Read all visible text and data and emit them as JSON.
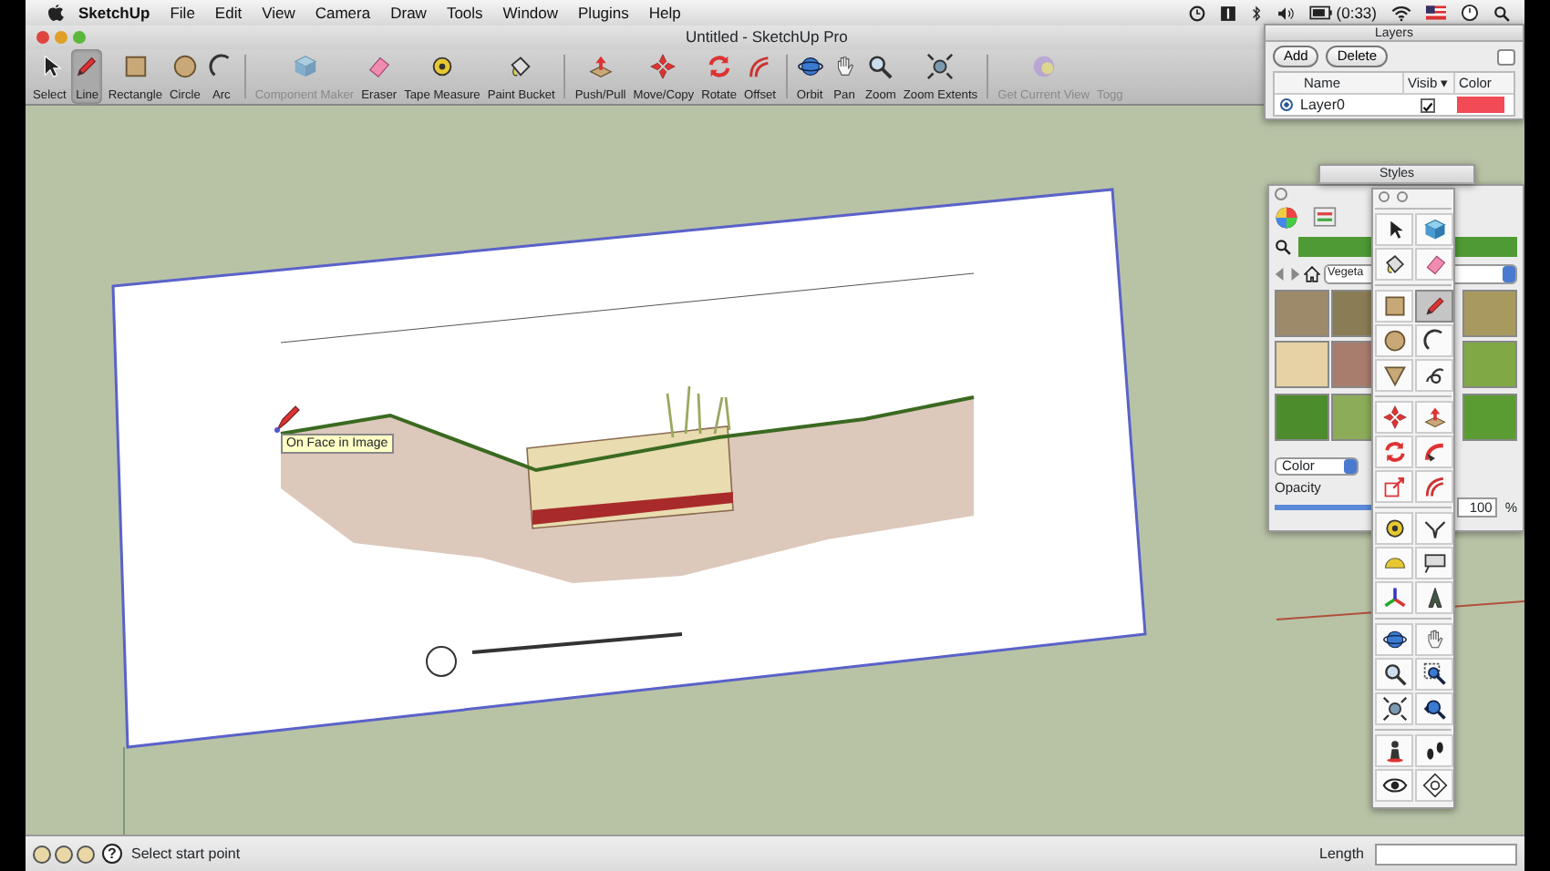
{
  "menubar": {
    "app": "SketchUp",
    "menus": [
      "File",
      "Edit",
      "View",
      "Camera",
      "Draw",
      "Tools",
      "Window",
      "Plugins",
      "Help"
    ],
    "battery": "(0:33)"
  },
  "window": {
    "title": "Untitled - SketchUp Pro"
  },
  "toolbar": [
    [
      {
        "label": "Select",
        "kind": "select",
        "selected": false,
        "disabled": false
      },
      {
        "label": "Line",
        "kind": "line",
        "selected": true,
        "disabled": false
      },
      {
        "label": "Rectangle",
        "kind": "rectangle",
        "selected": false,
        "disabled": false
      },
      {
        "label": "Circle",
        "kind": "circle",
        "selected": false,
        "disabled": false
      },
      {
        "label": "Arc",
        "kind": "arc",
        "selected": false,
        "disabled": false
      }
    ],
    [
      {
        "label": "Component Maker",
        "kind": "component",
        "selected": false,
        "disabled": true
      },
      {
        "label": "Eraser",
        "kind": "eraser",
        "selected": false,
        "disabled": false
      },
      {
        "label": "Tape Measure",
        "kind": "tape",
        "selected": false,
        "disabled": false
      },
      {
        "label": "Paint Bucket",
        "kind": "bucket",
        "selected": false,
        "disabled": false
      }
    ],
    [
      {
        "label": "Push/Pull",
        "kind": "pushpull",
        "selected": false,
        "disabled": false
      },
      {
        "label": "Move/Copy",
        "kind": "move",
        "selected": false,
        "disabled": false
      },
      {
        "label": "Rotate",
        "kind": "rotate",
        "selected": false,
        "disabled": false
      },
      {
        "label": "Offset",
        "kind": "offset",
        "selected": false,
        "disabled": false
      }
    ],
    [
      {
        "label": "Orbit",
        "kind": "orbit",
        "selected": false,
        "disabled": false
      },
      {
        "label": "Pan",
        "kind": "pan",
        "selected": false,
        "disabled": false
      },
      {
        "label": "Zoom",
        "kind": "zoom",
        "selected": false,
        "disabled": false
      },
      {
        "label": "Zoom Extents",
        "kind": "extents",
        "selected": false,
        "disabled": false
      }
    ],
    [
      {
        "label": "Get Current View",
        "kind": "view",
        "selected": false,
        "disabled": true
      },
      {
        "label": "Togg",
        "kind": "none",
        "selected": false,
        "disabled": true
      }
    ]
  ],
  "tooltip": "On Face in Image",
  "layers_panel": {
    "title": "Layers",
    "buttons": [
      "Add",
      "Delete"
    ],
    "columns": [
      "Name",
      "Visib ▾",
      "Color"
    ],
    "layers": [
      {
        "name": "Layer0",
        "selected": true,
        "visible": true,
        "color": "#f24b55"
      }
    ]
  },
  "styles_panel": {
    "title": "Styles"
  },
  "materials_panel": {
    "collection": "Vegeta",
    "swatches": [
      {
        "color": "#9c8a6a"
      },
      {
        "color": "#8a7d55"
      },
      {
        "color": "#a89a5e"
      },
      {
        "color": "#e6d2a4"
      },
      {
        "color": "#a87d6e"
      },
      {
        "color": "#80a845"
      },
      {
        "color": "#4c8c2c"
      },
      {
        "color": "#8cac5a"
      },
      {
        "color": "#5a9c32"
      }
    ],
    "mode": "Color",
    "opacity_label": "Opacity",
    "opacity": {
      "level": 1,
      "value": "100",
      "unit": "%"
    }
  },
  "tool_palette": [
    [
      {
        "kind": "select",
        "selected": false
      },
      {
        "kind": "component",
        "selected": false
      },
      {
        "kind": "bucket",
        "selected": false
      },
      {
        "kind": "eraser",
        "selected": false
      }
    ],
    [
      {
        "kind": "rectangle",
        "selected": false
      },
      {
        "kind": "line",
        "selected": true
      },
      {
        "kind": "circle",
        "selected": false
      },
      {
        "kind": "arc",
        "selected": false
      },
      {
        "kind": "polygon",
        "selected": false
      },
      {
        "kind": "freehand",
        "selected": false
      }
    ],
    [
      {
        "kind": "move",
        "selected": false
      },
      {
        "kind": "pushpull",
        "selected": false
      },
      {
        "kind": "rotate",
        "selected": false
      },
      {
        "kind": "followme",
        "selected": false
      },
      {
        "kind": "scale",
        "selected": false
      },
      {
        "kind": "offset",
        "selected": false
      }
    ],
    [
      {
        "kind": "tape",
        "selected": false
      },
      {
        "kind": "dimension",
        "selected": false
      },
      {
        "kind": "protractor",
        "selected": false
      },
      {
        "kind": "text",
        "selected": false
      },
      {
        "kind": "axes",
        "selected": false
      },
      {
        "kind": "text3d",
        "selected": false
      }
    ],
    [
      {
        "kind": "orbit",
        "selected": false
      },
      {
        "kind": "pan",
        "selected": false
      },
      {
        "kind": "zoom",
        "selected": false
      },
      {
        "kind": "zoomwindow",
        "selected": false
      },
      {
        "kind": "extents",
        "selected": false
      },
      {
        "kind": "previous",
        "selected": false
      }
    ],
    [
      {
        "kind": "camera",
        "selected": false
      },
      {
        "kind": "walk",
        "selected": false
      },
      {
        "kind": "look",
        "selected": false
      },
      {
        "kind": "section",
        "selected": false
      }
    ]
  ],
  "status_bar": {
    "help": "?",
    "message": "Select start point",
    "length_label": "Length"
  }
}
